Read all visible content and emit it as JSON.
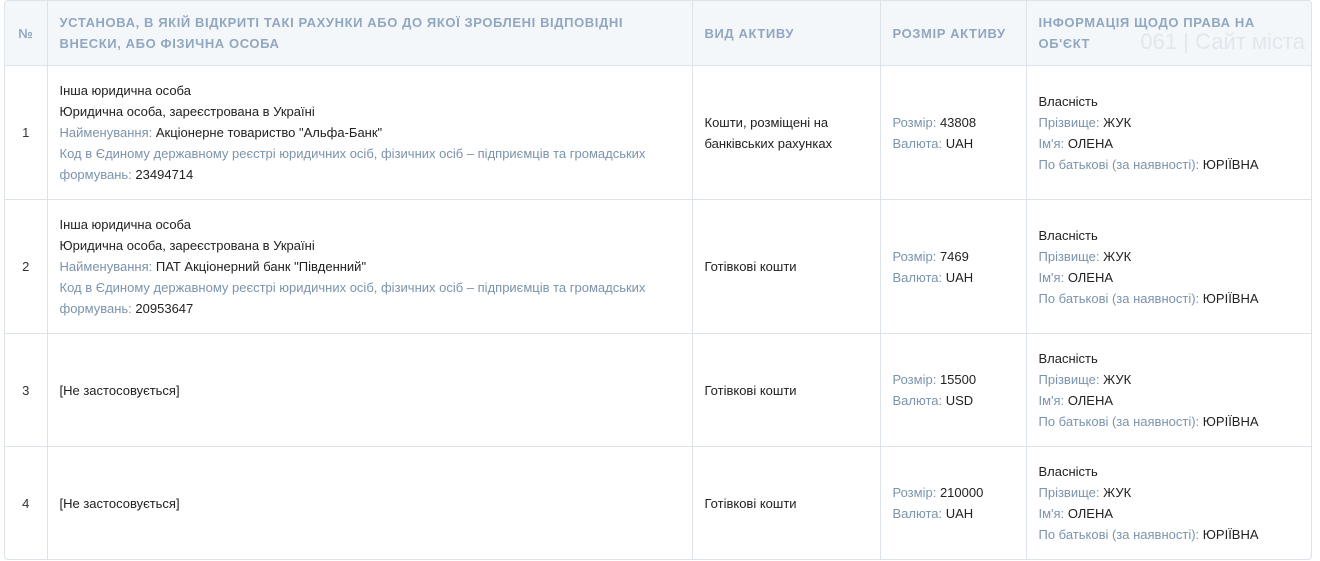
{
  "watermark": "061 | Сайт міста",
  "headers": {
    "num": "№",
    "institution": "Установа, в якій відкриті такі рахунки або до якої зроблені відповідні внески, або фізична особа",
    "asset_type": "Вид активу",
    "asset_size": "Розмір активу",
    "right_info": "Інформація щодо права на об'єкт"
  },
  "labels": {
    "name": "Найменування:",
    "code": "Код в Єдиному державному реєстрі юридичних осіб, фізичних осіб – підприємців та громадських формувань:",
    "size": "Розмір:",
    "currency": "Валюта:",
    "surname": "Прізвище:",
    "first_name": "Ім'я:",
    "patronymic": "По батькові (за наявності):"
  },
  "rows": [
    {
      "num": "1",
      "entity_type": "Інша юридична особа",
      "entity_reg": "Юридична особа, зареєстрована в Україні",
      "name": "Акціонерне товариство \"Альфа-Банк\"",
      "code": "23494714",
      "asset_type": "Кошти, розміщені на банківських рахунках",
      "size": "43808",
      "currency": "UAH",
      "right": "Власність",
      "surname": "ЖУК",
      "first_name": "ОЛЕНА",
      "patronymic": "ЮРІЇВНА"
    },
    {
      "num": "2",
      "entity_type": "Інша юридична особа",
      "entity_reg": "Юридична особа, зареєстрована в Україні",
      "name": "ПАТ Акціонерний банк \"Південний\"",
      "code": "20953647",
      "asset_type": "Готівкові кошти",
      "size": "7469",
      "currency": "UAH",
      "right": "Власність",
      "surname": "ЖУК",
      "first_name": "ОЛЕНА",
      "patronymic": "ЮРІЇВНА"
    },
    {
      "num": "3",
      "na": "[Не застосовується]",
      "asset_type": "Готівкові кошти",
      "size": "15500",
      "currency": "USD",
      "right": "Власність",
      "surname": "ЖУК",
      "first_name": "ОЛЕНА",
      "patronymic": "ЮРІЇВНА"
    },
    {
      "num": "4",
      "na": "[Не застосовується]",
      "asset_type": "Готівкові кошти",
      "size": "210000",
      "currency": "UAH",
      "right": "Власність",
      "surname": "ЖУК",
      "first_name": "ОЛЕНА",
      "patronymic": "ЮРІЇВНА"
    }
  ]
}
